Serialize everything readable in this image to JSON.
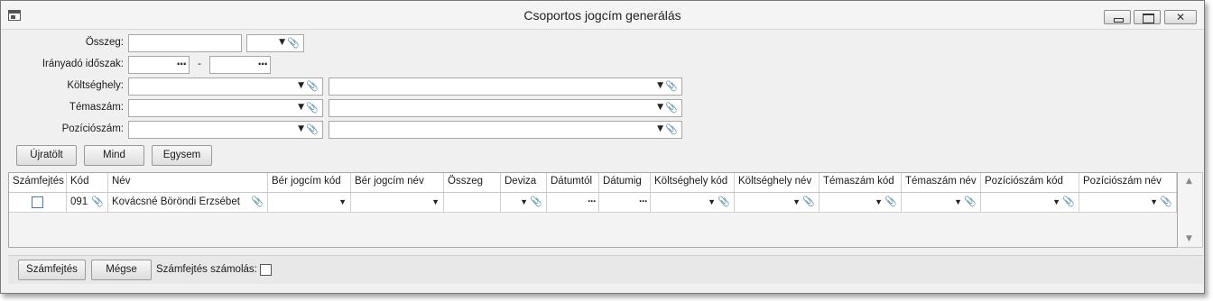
{
  "window": {
    "title": "Csoportos jogcím generálás"
  },
  "filters": {
    "osszeg_label": "Összeg:",
    "iranyado_label": "Irányadó időszak:",
    "range_separator": "-",
    "koltseghely_label": "Költséghely:",
    "temaszam_label": "Témaszám:",
    "pozicioszam_label": "Pozíciószám:"
  },
  "actions": {
    "reload": "Újratölt",
    "all": "Mind",
    "single": "Egysem"
  },
  "grid": {
    "columns": [
      "Számfejtés",
      "Kód",
      "Név",
      "Bér jogcím kód",
      "Bér jogcím név",
      "Összeg",
      "Deviza",
      "Dátumtól",
      "Dátumig",
      "Költséghely kód",
      "Költséghely név",
      "Témaszám kód",
      "Témaszám név",
      "Pozíciószám kód",
      "Pozíciószám név"
    ],
    "rows": [
      {
        "kod": "091",
        "nev": "Kovácsné Böröndi Erzsébet",
        "szamfejtes_checked": false
      }
    ]
  },
  "footer": {
    "szamfejtes": "Számfejtés",
    "megse": "Mégse",
    "szamolas_label": "Számfejtés számolás:",
    "szamolas_checked": false
  }
}
